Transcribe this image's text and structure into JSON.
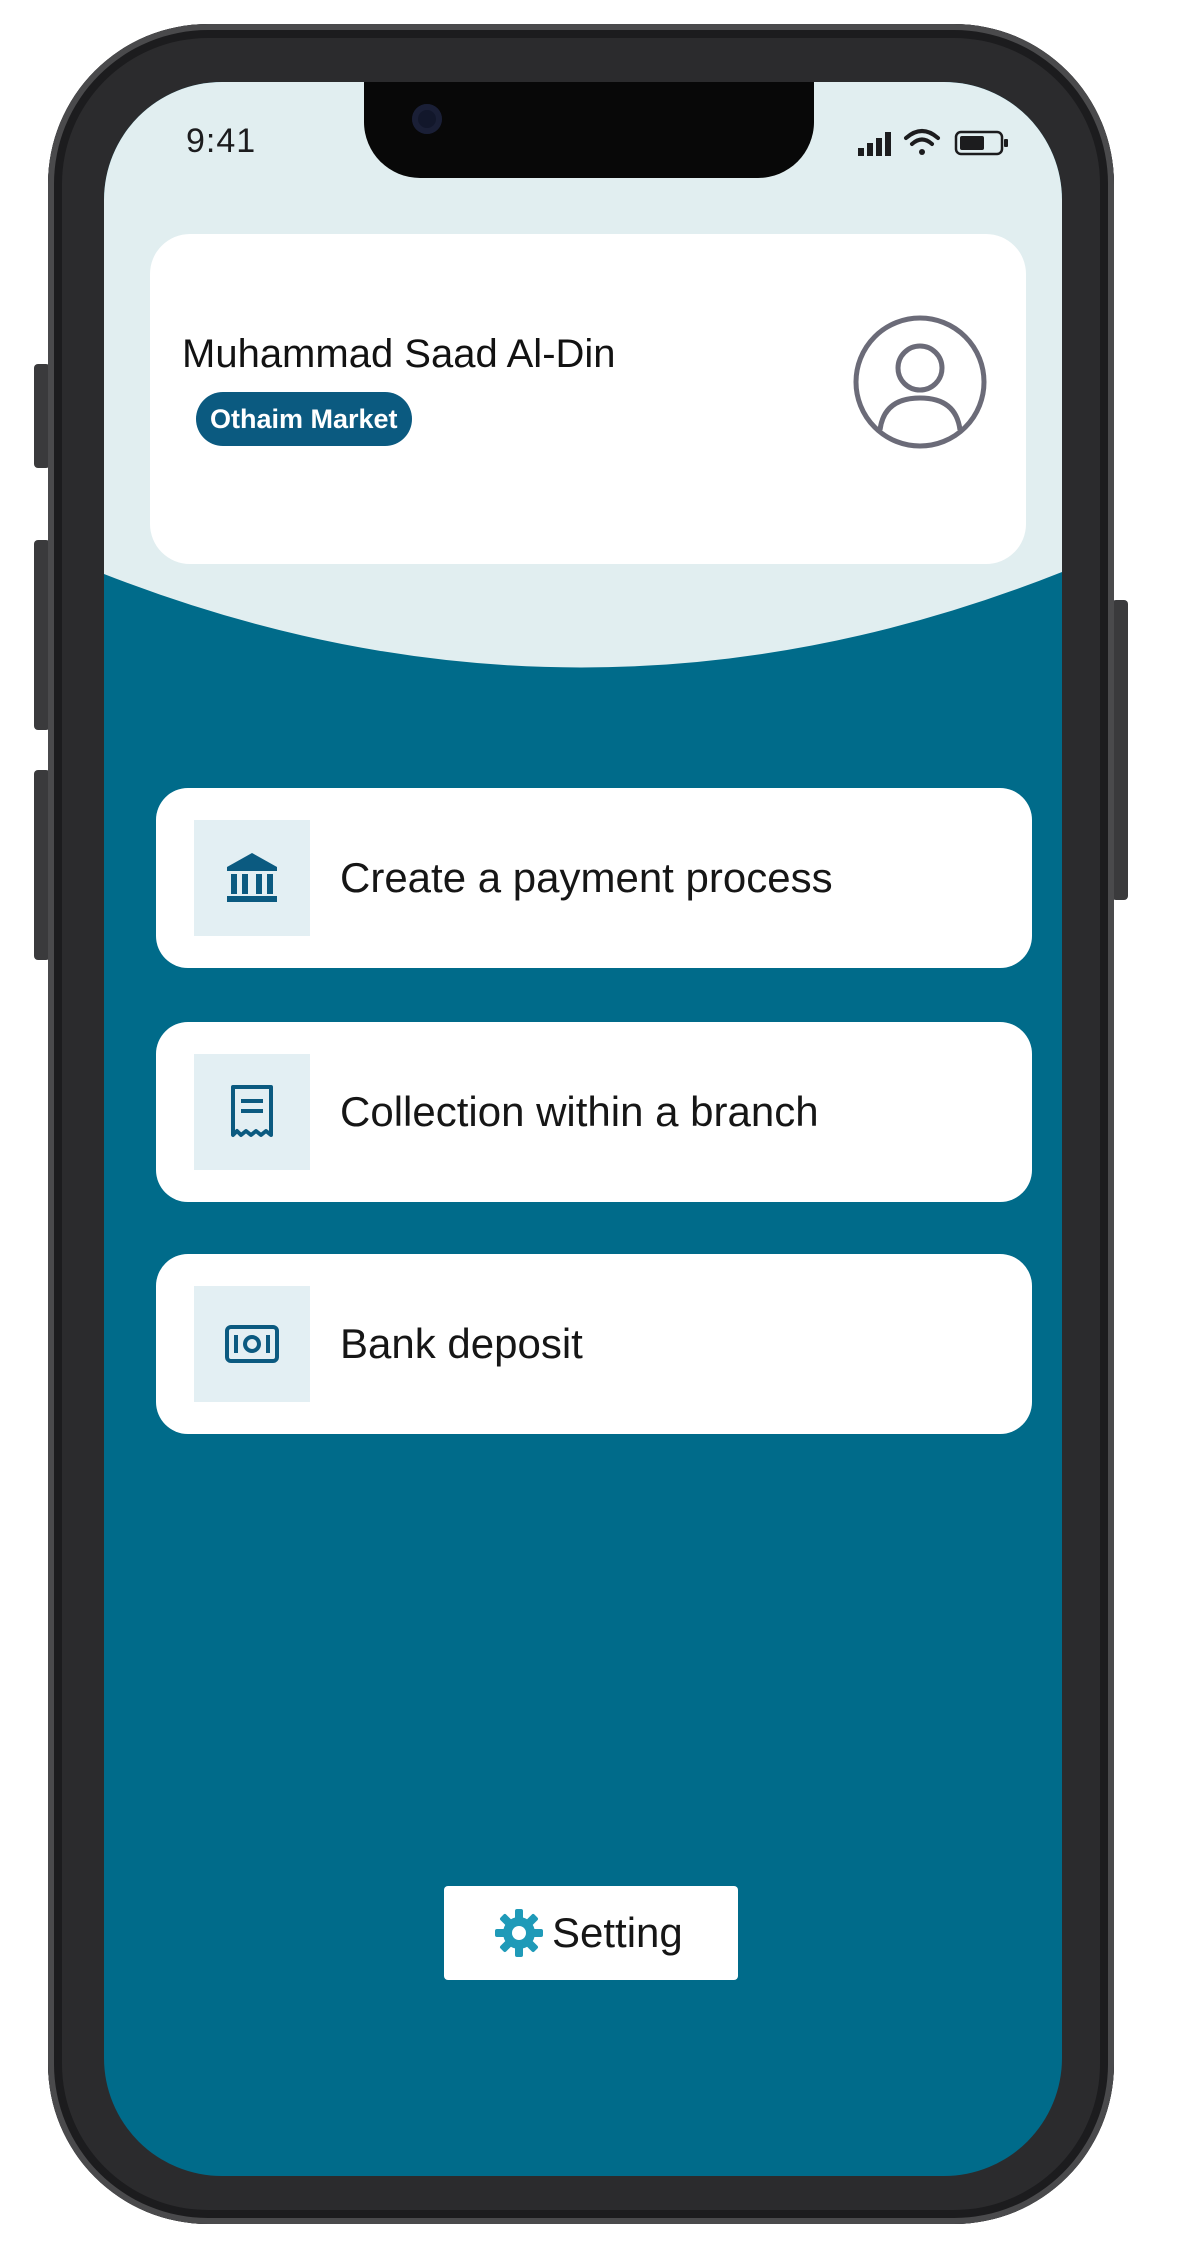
{
  "status_bar": {
    "time": "9:41",
    "icons": [
      "cellular-signal-icon",
      "wifi-icon",
      "battery-icon"
    ]
  },
  "profile": {
    "name": "Muhammad Saad Al-Din",
    "company": "Othaim Market",
    "avatar_icon": "user-avatar-icon"
  },
  "menu": {
    "items": [
      {
        "label": "Create a payment process",
        "icon": "bank-icon"
      },
      {
        "label": "Collection within a branch",
        "icon": "receipt-icon"
      },
      {
        "label": "Bank deposit",
        "icon": "cash-icon"
      }
    ]
  },
  "settings": {
    "label": "Setting",
    "icon": "gear-icon"
  },
  "colors": {
    "primary": "#006b8a",
    "header_background": "#e1eef0",
    "badge": "#0b5a80",
    "icon_tile": "#e3eff3",
    "icon": "#0b5a80",
    "gear": "#1f9ab8"
  }
}
